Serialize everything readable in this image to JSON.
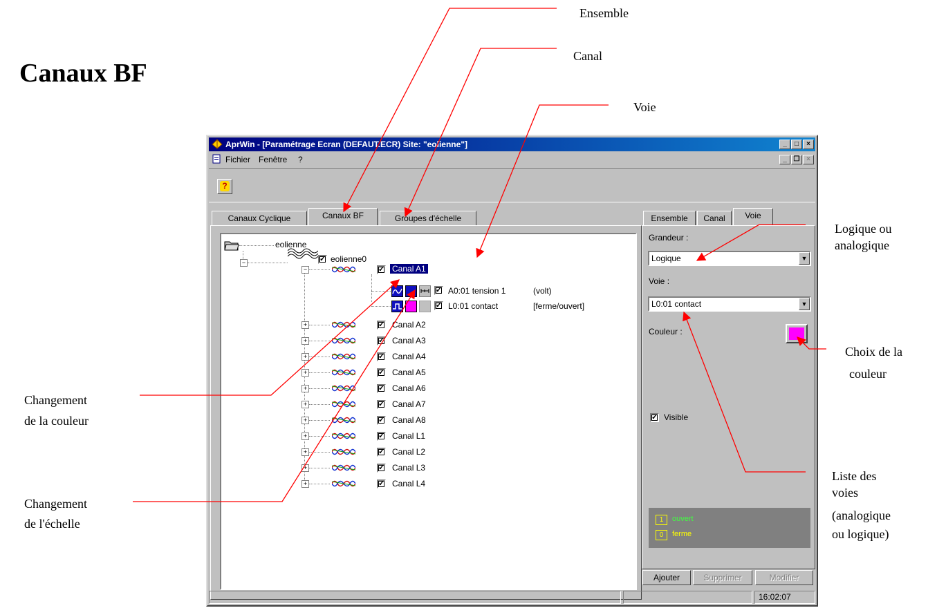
{
  "page_title": "Canaux BF",
  "annotations": {
    "ensemble": "Ensemble",
    "canal": "Canal",
    "voie": "Voie",
    "logique_line1": "Logique ou",
    "logique_line2": "analogique",
    "choix_line1": "Choix de la",
    "choix_line2": "couleur",
    "liste_line1": "Liste des",
    "liste_line2": "voies",
    "liste_line3": "(analogique",
    "liste_line4": "ou logique)",
    "chg_couleur_line1": "Changement",
    "chg_couleur_line2": "de la couleur",
    "chg_echelle_line1": "Changement",
    "chg_echelle_line2": "de l'échelle"
  },
  "window": {
    "title": "AprWin  - [Paramétrage Ecran  (DEFAUT.ECR)  Site: \"eolienne\"]",
    "menu": {
      "fichier": "Fichier",
      "fenetre": "Fenêtre",
      "help": "?"
    },
    "tabs": {
      "cyclique": "Canaux Cyclique",
      "bf": "Canaux BF",
      "groupes": "Groupes d'échelle"
    },
    "tree": {
      "root": "eolienne",
      "ensemble": "eolienne0",
      "selected_canal": "Canal A1",
      "voie1": "A0:01 tension 1",
      "voie1_unit": "(volt)",
      "voie2": "L0:01 contact",
      "voie2_unit": "[ferme/ouvert]",
      "canaux": [
        "Canal A2",
        "Canal A3",
        "Canal A4",
        "Canal A5",
        "Canal A6",
        "Canal A7",
        "Canal A8",
        "Canal L1",
        "Canal L2",
        "Canal L3",
        "Canal L4"
      ]
    },
    "right_tabs": {
      "ensemble": "Ensemble",
      "canal": "Canal",
      "voie": "Voie"
    },
    "grandeur_label": "Grandeur :",
    "grandeur_value": "Logique",
    "voie_label": "Voie :",
    "voie_value": "L0:01 contact",
    "couleur_label": "Couleur :",
    "visible_label": "Visible",
    "legend": {
      "one": "ouvert",
      "zero": "ferme"
    },
    "buttons": {
      "ajouter": "Ajouter",
      "supprimer": "Supprimer",
      "modifier": "Modifier"
    },
    "status_time": "16:02:07"
  },
  "colors": {
    "voie_color": "#ff00ff",
    "selection": "#000080",
    "arrow": "#ff0000"
  }
}
